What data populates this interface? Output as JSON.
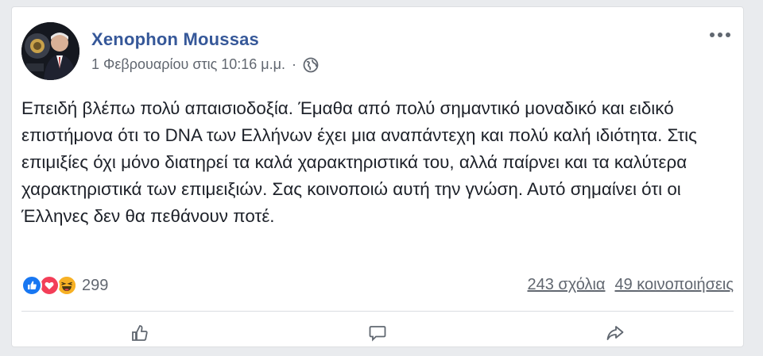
{
  "post": {
    "author": "Xenophon Moussas",
    "timestamp": "1 Φεβρουαρίου στις 10:16 μ.μ.",
    "separator": "·",
    "privacy_icon": "globe-icon",
    "more_icon": "more-options-icon",
    "text": "Επειδή βλέπω πολύ απαισιοδοξία. Έμαθα από πολύ σημαντικό μοναδικό και ειδικό επιστήμονα ότι το DNA των Ελλήνων έχει μια αναπάντεχη και πολύ καλή ιδιότητα. Στις επιμιξίες όχι μόνο διατηρεί τα καλά χαρακτηριστικά του, αλλά παίρνει και τα καλύτερα χαρακτηριστικά των επιμειξιών. Σας κοινοποιώ αυτή την γνώση. Αυτό σημαίνει ότι οι Έλληνες δεν θα πεθάνουν ποτέ."
  },
  "stats": {
    "reaction_icons": [
      "like-icon",
      "love-icon",
      "haha-icon"
    ],
    "reaction_count": "299",
    "comments": "243 σχόλια",
    "shares": "49 κοινοποιήσεις"
  },
  "colors": {
    "link": "#365899",
    "like": "#1877f2",
    "love": "#f33e58",
    "haha": "#f7b125"
  }
}
